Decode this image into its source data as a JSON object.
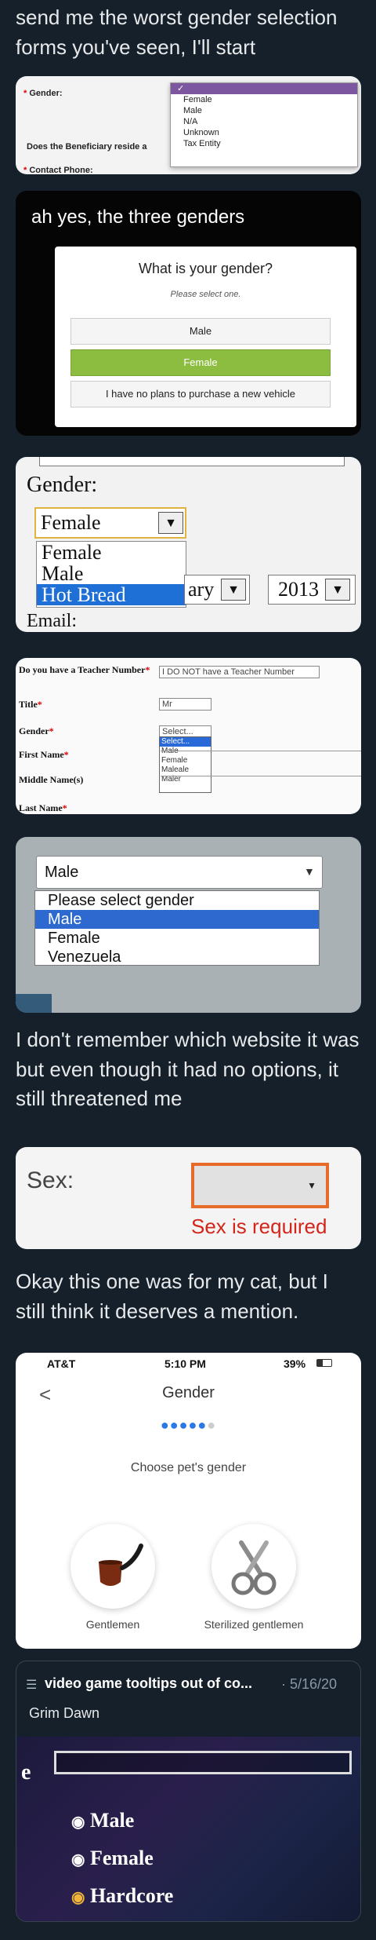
{
  "captions": {
    "intro": "send me the worst gender selection forms you've seen, I'll start",
    "threatened": "I don't remember which website it was but even though it had no options, it still threatened me",
    "cat": "Okay this one was for my cat, but I still think it deserves a mention."
  },
  "form1": {
    "gender_label": "Gender:",
    "beneficiary_label": "Does the Beneficiary reside a",
    "contact_label": "Contact Phone:",
    "checkmark": "✓",
    "options": [
      "Female",
      "Male",
      "N/A",
      "Unknown",
      "Tax Entity"
    ]
  },
  "form2": {
    "heading": "ah yes, the three genders",
    "question": "What is your gender?",
    "subtitle": "Please select one.",
    "options": [
      "Male",
      "Female",
      "I have no plans to purchase a new vehicle"
    ]
  },
  "form3": {
    "gender_label": "Gender:",
    "selected": "Female",
    "options": [
      "Female",
      "Male",
      "Hot Bread"
    ],
    "month_partial": "ary",
    "year": "2013",
    "email_label": "Email:"
  },
  "form4": {
    "teacher_label": "Do you have a Teacher Number",
    "teacher_value": "I DO NOT have a Teacher Number",
    "title_label": "Title",
    "title_value": "Mr",
    "gender_label": "Gender",
    "gender_value": "Select...",
    "first_label": "First Name",
    "middle_label": "Middle Name(s)",
    "last_label": "Last Name",
    "options": [
      "Select...",
      "Male",
      "Female",
      "Maleale",
      "Maler"
    ]
  },
  "form5": {
    "selected": "Male",
    "options": [
      "Please select gender",
      "Male",
      "Female",
      "Venezuela"
    ]
  },
  "form6": {
    "label": "Sex:",
    "error": "Sex is required"
  },
  "form7": {
    "carrier": "AT&T",
    "time": "5:10 PM",
    "battery": "39%",
    "title": "Gender",
    "back": "<",
    "prompt": "Choose pet's gender",
    "options": [
      "Gentlemen",
      "Sterilized gentlemen"
    ]
  },
  "tweet": {
    "title": "video game tooltips out of co...",
    "date": "· 5/16/20",
    "subtitle": "Grim Dawn",
    "letter": "e",
    "options": [
      "Male",
      "Female",
      "Hardcore"
    ]
  }
}
